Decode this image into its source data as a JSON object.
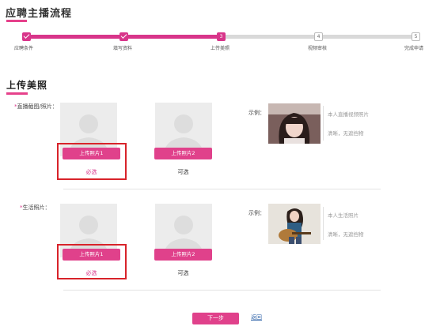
{
  "page": {
    "title": "应聘主播流程"
  },
  "steps": [
    {
      "label": "应聘条件",
      "badge": "",
      "state": "done"
    },
    {
      "label": "填写资料",
      "badge": "",
      "state": "done"
    },
    {
      "label": "上传美照",
      "badge": "3",
      "state": "current"
    },
    {
      "label": "视频审核",
      "badge": "4",
      "state": "todo"
    },
    {
      "label": "完成申请",
      "badge": "5",
      "state": "todo"
    }
  ],
  "section": {
    "title": "上传美照"
  },
  "groups": [
    {
      "label_required": "*",
      "label": "直播截图/照片：",
      "primary_button": "上传照片1",
      "primary_hint": "必选",
      "secondary_button": "上传照片2",
      "secondary_hint": "可选",
      "example_label": "示例：",
      "notes": [
        "本人直播视频照片",
        "清晰，无遮挡物"
      ]
    },
    {
      "label_required": "*",
      "label": "生活照片：",
      "primary_button": "上传照片1",
      "primary_hint": "必选",
      "secondary_button": "上传照片2",
      "secondary_hint": "可选",
      "example_label": "示例：",
      "notes": [
        "本人生活照片",
        "清晰，无遮挡物"
      ]
    }
  ],
  "footer": {
    "next_label": "下一步",
    "back_label": "返回"
  },
  "colors": {
    "accent": "#e0418b",
    "highlight_frame": "#d8232a",
    "track": "#d9d9d9"
  }
}
